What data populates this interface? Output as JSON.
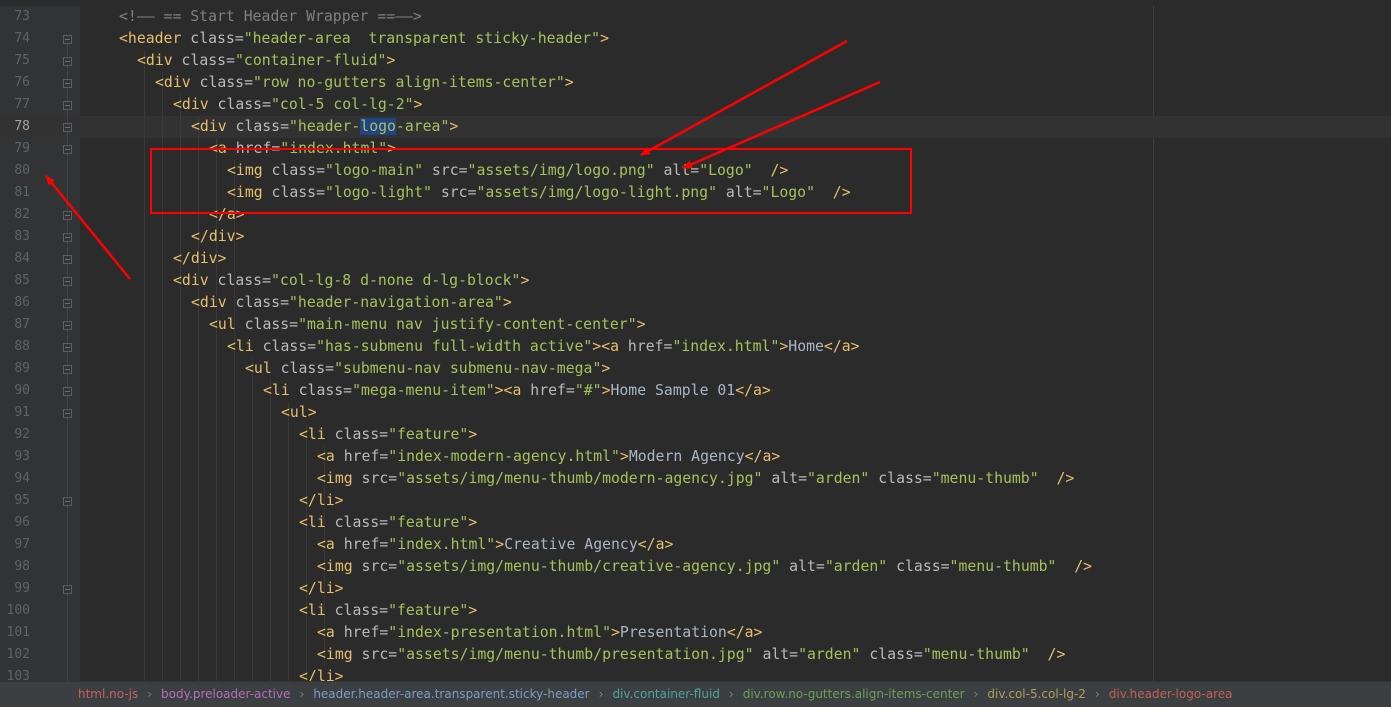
{
  "editor": {
    "first_line": 73,
    "current_line": 78,
    "lines": [
      {
        "num": "73",
        "indent": 2,
        "tokens": [
          [
            "cmt",
            "<!—— == Start Header Wrapper ==——>"
          ]
        ]
      },
      {
        "num": "74",
        "indent": 2,
        "tokens": [
          [
            "tag",
            "<header "
          ],
          [
            "attr",
            "class="
          ],
          [
            "val",
            "\"header-area  transparent sticky-header\""
          ],
          [
            "tag",
            ">"
          ]
        ]
      },
      {
        "num": "75",
        "indent": 3,
        "tokens": [
          [
            "tag",
            "<div "
          ],
          [
            "attr",
            "class="
          ],
          [
            "val",
            "\"container-fluid\""
          ],
          [
            "tag",
            ">"
          ]
        ]
      },
      {
        "num": "76",
        "indent": 4,
        "tokens": [
          [
            "tag",
            "<div "
          ],
          [
            "attr",
            "class="
          ],
          [
            "val",
            "\"row no-gutters align-items-center\""
          ],
          [
            "tag",
            ">"
          ]
        ]
      },
      {
        "num": "77",
        "indent": 5,
        "tokens": [
          [
            "tag",
            "<div "
          ],
          [
            "attr",
            "class="
          ],
          [
            "val",
            "\"col-5 col-lg-2\""
          ],
          [
            "tag",
            ">"
          ]
        ]
      },
      {
        "num": "78",
        "indent": 6,
        "tokens": [
          [
            "tag",
            "<div "
          ],
          [
            "attr",
            "class="
          ],
          [
            "val",
            "\"header-"
          ],
          [
            "hl",
            "logo"
          ],
          [
            "val",
            "-area\""
          ],
          [
            "tag",
            ">"
          ]
        ]
      },
      {
        "num": "79",
        "indent": 7,
        "tokens": [
          [
            "tag",
            "<a "
          ],
          [
            "attr",
            "href="
          ],
          [
            "val",
            "\"index.html\""
          ],
          [
            "tag",
            ">"
          ]
        ]
      },
      {
        "num": "80",
        "indent": 8,
        "tokens": [
          [
            "tag",
            "<img "
          ],
          [
            "attr",
            "class="
          ],
          [
            "val",
            "\"logo-main\" "
          ],
          [
            "attr",
            "src="
          ],
          [
            "val",
            "\"assets/img/logo.png\" "
          ],
          [
            "attr",
            "alt="
          ],
          [
            "val",
            "\"Logo\" "
          ],
          [
            "tag",
            " />"
          ]
        ]
      },
      {
        "num": "81",
        "indent": 8,
        "tokens": [
          [
            "tag",
            "<img "
          ],
          [
            "attr",
            "class="
          ],
          [
            "val",
            "\"logo-light\" "
          ],
          [
            "attr",
            "src="
          ],
          [
            "val",
            "\"assets/img/logo-light.png\" "
          ],
          [
            "attr",
            "alt="
          ],
          [
            "val",
            "\"Logo\" "
          ],
          [
            "tag",
            " />"
          ]
        ]
      },
      {
        "num": "82",
        "indent": 7,
        "tokens": [
          [
            "tag",
            "</a>"
          ]
        ]
      },
      {
        "num": "83",
        "indent": 6,
        "tokens": [
          [
            "tag",
            "</div>"
          ]
        ]
      },
      {
        "num": "84",
        "indent": 5,
        "tokens": [
          [
            "tag",
            "</div>"
          ]
        ]
      },
      {
        "num": "85",
        "indent": 5,
        "tokens": [
          [
            "tag",
            "<div "
          ],
          [
            "attr",
            "class="
          ],
          [
            "val",
            "\"col-lg-8 d-none d-lg-block\""
          ],
          [
            "tag",
            ">"
          ]
        ]
      },
      {
        "num": "86",
        "indent": 6,
        "tokens": [
          [
            "tag",
            "<div "
          ],
          [
            "attr",
            "class="
          ],
          [
            "val",
            "\"header-navigation-area\""
          ],
          [
            "tag",
            ">"
          ]
        ]
      },
      {
        "num": "87",
        "indent": 7,
        "tokens": [
          [
            "tag",
            "<ul "
          ],
          [
            "attr",
            "class="
          ],
          [
            "val",
            "\"main-menu nav justify-content-center\""
          ],
          [
            "tag",
            ">"
          ]
        ]
      },
      {
        "num": "88",
        "indent": 8,
        "tokens": [
          [
            "tag",
            "<li "
          ],
          [
            "attr",
            "class="
          ],
          [
            "val",
            "\"has-submenu full-width active\""
          ],
          [
            "tag",
            "><a "
          ],
          [
            "attr",
            "href="
          ],
          [
            "val",
            "\"index.html\""
          ],
          [
            "tag",
            ">"
          ],
          [
            "txt",
            "Home"
          ],
          [
            "tag",
            "</a>"
          ]
        ]
      },
      {
        "num": "89",
        "indent": 9,
        "tokens": [
          [
            "tag",
            "<ul "
          ],
          [
            "attr",
            "class="
          ],
          [
            "val",
            "\"submenu-nav submenu-nav-mega\""
          ],
          [
            "tag",
            ">"
          ]
        ]
      },
      {
        "num": "90",
        "indent": 10,
        "tokens": [
          [
            "tag",
            "<li "
          ],
          [
            "attr",
            "class="
          ],
          [
            "val",
            "\"mega-menu-item\""
          ],
          [
            "tag",
            "><a "
          ],
          [
            "attr",
            "href="
          ],
          [
            "val",
            "\"#\""
          ],
          [
            "tag",
            ">"
          ],
          [
            "txt",
            "Home Sample 01"
          ],
          [
            "tag",
            "</a>"
          ]
        ]
      },
      {
        "num": "91",
        "indent": 11,
        "tokens": [
          [
            "tag",
            "<ul>"
          ]
        ]
      },
      {
        "num": "92",
        "indent": 12,
        "tokens": [
          [
            "tag",
            "<li "
          ],
          [
            "attr",
            "class="
          ],
          [
            "val",
            "\"feature\""
          ],
          [
            "tag",
            ">"
          ]
        ]
      },
      {
        "num": "93",
        "indent": 13,
        "tokens": [
          [
            "tag",
            "<a "
          ],
          [
            "attr",
            "href="
          ],
          [
            "val",
            "\"index-modern-agency.html\""
          ],
          [
            "tag",
            ">"
          ],
          [
            "txt",
            "Modern Agency"
          ],
          [
            "tag",
            "</a>"
          ]
        ]
      },
      {
        "num": "94",
        "indent": 13,
        "tokens": [
          [
            "tag",
            "<img "
          ],
          [
            "attr",
            "src="
          ],
          [
            "val",
            "\"assets/img/menu-thumb/modern-agency.jpg\" "
          ],
          [
            "attr",
            "alt="
          ],
          [
            "val",
            "\"arden\" "
          ],
          [
            "attr",
            "class="
          ],
          [
            "val",
            "\"menu-thumb\" "
          ],
          [
            "tag",
            " />"
          ]
        ]
      },
      {
        "num": "95",
        "indent": 12,
        "tokens": [
          [
            "tag",
            "</li>"
          ]
        ]
      },
      {
        "num": "96",
        "indent": 12,
        "tokens": [
          [
            "tag",
            "<li "
          ],
          [
            "attr",
            "class="
          ],
          [
            "val",
            "\"feature\""
          ],
          [
            "tag",
            ">"
          ]
        ]
      },
      {
        "num": "97",
        "indent": 13,
        "tokens": [
          [
            "tag",
            "<a "
          ],
          [
            "attr",
            "href="
          ],
          [
            "val",
            "\"index.html\""
          ],
          [
            "tag",
            ">"
          ],
          [
            "txt",
            "Creative Agency"
          ],
          [
            "tag",
            "</a>"
          ]
        ]
      },
      {
        "num": "98",
        "indent": 13,
        "tokens": [
          [
            "tag",
            "<img "
          ],
          [
            "attr",
            "src="
          ],
          [
            "val",
            "\"assets/img/menu-thumb/creative-agency.jpg\" "
          ],
          [
            "attr",
            "alt="
          ],
          [
            "val",
            "\"arden\" "
          ],
          [
            "attr",
            "class="
          ],
          [
            "val",
            "\"menu-thumb\" "
          ],
          [
            "tag",
            " />"
          ]
        ]
      },
      {
        "num": "99",
        "indent": 12,
        "tokens": [
          [
            "tag",
            "</li>"
          ]
        ]
      },
      {
        "num": "100",
        "indent": 12,
        "tokens": [
          [
            "tag",
            "<li "
          ],
          [
            "attr",
            "class="
          ],
          [
            "val",
            "\"feature\""
          ],
          [
            "tag",
            ">"
          ]
        ]
      },
      {
        "num": "101",
        "indent": 13,
        "tokens": [
          [
            "tag",
            "<a "
          ],
          [
            "attr",
            "href="
          ],
          [
            "val",
            "\"index-presentation.html\""
          ],
          [
            "tag",
            ">"
          ],
          [
            "txt",
            "Presentation"
          ],
          [
            "tag",
            "</a>"
          ]
        ]
      },
      {
        "num": "102",
        "indent": 13,
        "tokens": [
          [
            "tag",
            "<img "
          ],
          [
            "attr",
            "src="
          ],
          [
            "val",
            "\"assets/img/menu-thumb/presentation.jpg\" "
          ],
          [
            "attr",
            "alt="
          ],
          [
            "val",
            "\"arden\" "
          ],
          [
            "attr",
            "class="
          ],
          [
            "val",
            "\"menu-thumb\" "
          ],
          [
            "tag",
            " />"
          ]
        ]
      },
      {
        "num": "103",
        "indent": 12,
        "tokens": [
          [
            "tag",
            "</li>"
          ]
        ]
      }
    ]
  },
  "breadcrumb": {
    "items": [
      {
        "label": "html.no-js",
        "color": "#c9605f"
      },
      {
        "label": "body.preloader-active",
        "color": "#b46fb8"
      },
      {
        "label": "header.header-area.transparent.sticky-header",
        "color": "#7a9ec2"
      },
      {
        "label": "div.container-fluid",
        "color": "#4fa39a"
      },
      {
        "label": "div.row.no-gutters.align-items-center",
        "color": "#6a9f5a"
      },
      {
        "label": "div.col-5.col-lg-2",
        "color": "#b09e5c"
      },
      {
        "label": "div.header-logo-area",
        "color": "#c06050"
      }
    ],
    "separator": "›"
  },
  "annotation": {
    "color": "#ff0000",
    "highlighted_lines": [
      "80",
      "81"
    ]
  },
  "fold_markers": [
    "74",
    "75",
    "76",
    "77",
    "78",
    "79",
    "82",
    "83",
    "84",
    "85",
    "86",
    "87",
    "88",
    "89",
    "90",
    "91",
    "95",
    "99"
  ]
}
